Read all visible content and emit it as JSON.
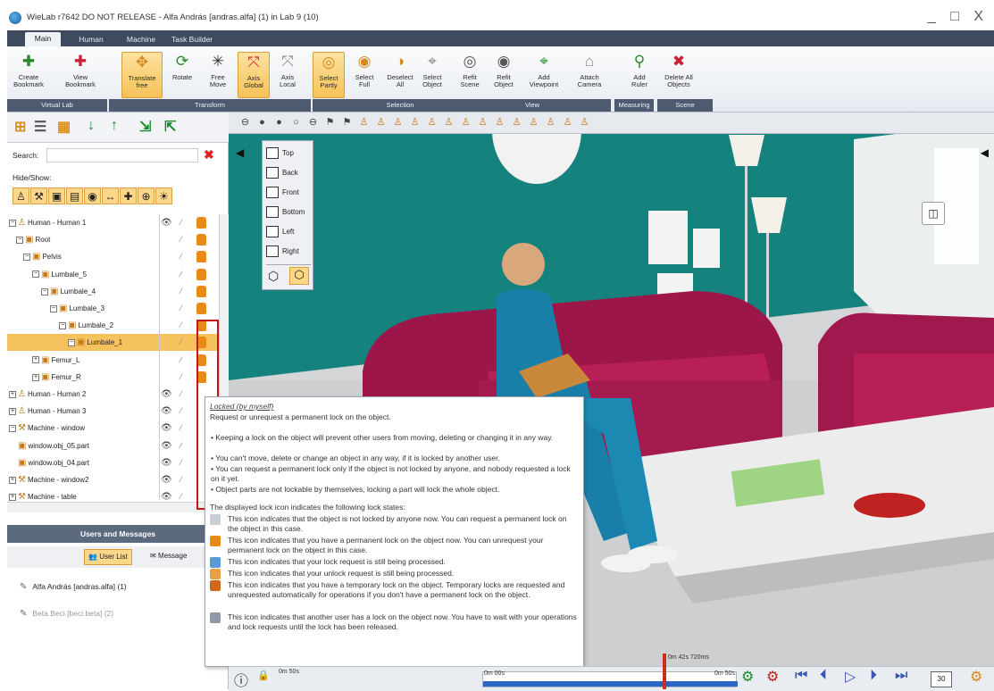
{
  "window": {
    "title": "WieLab r7642 DO NOT RELEASE - Alfa András [andras.alfa] (1) in Lab 9 (10)",
    "controls": "_ □ X"
  },
  "tabs": [
    "Main",
    "Human",
    "Machine",
    "Task Builder"
  ],
  "ribbon": {
    "buttons": [
      {
        "label": "Create\nBookmark",
        "icon": "create-bookmark-icon"
      },
      {
        "label": "View\nBookmark",
        "icon": "view-bookmark-icon"
      },
      {
        "label": "Translate\nfree",
        "icon": "translate-icon"
      },
      {
        "label": "Rotate",
        "icon": "rotate-icon"
      },
      {
        "label": "Free\nMove",
        "icon": "free-move-icon"
      },
      {
        "label": "Axis\nGlobal",
        "icon": "axis-global-icon"
      },
      {
        "label": "Axis\nLocal",
        "icon": "axis-local-icon"
      },
      {
        "label": "Select\nPartly",
        "icon": "select-partly-icon"
      },
      {
        "label": "Select\nFull",
        "icon": "select-full-icon"
      },
      {
        "label": "Deselect\nAll",
        "icon": "deselect-all-icon"
      },
      {
        "label": "Select\nObject",
        "icon": "select-object-icon"
      },
      {
        "label": "Refit\nScene",
        "icon": "refit-scene-icon"
      },
      {
        "label": "Refit\nObject",
        "icon": "refit-object-icon"
      },
      {
        "label": "Add\nViewpoint",
        "icon": "add-viewpoint-icon"
      },
      {
        "label": "Attach\nCamera",
        "icon": "attach-camera-icon"
      },
      {
        "label": "Add\nRuler",
        "icon": "add-ruler-icon"
      },
      {
        "label": "Delete All\nObjects",
        "icon": "delete-all-icon"
      }
    ],
    "groups": [
      "Virtual Lab",
      "Transform",
      "Selection",
      "View",
      "Measuring",
      "Scene"
    ]
  },
  "left_panel": {
    "search_label": "Search:",
    "search_value": "",
    "hide_show_label": "Hide/Show:",
    "tree": [
      "Human - Human 1",
      "Root",
      "Pelvis",
      "Lumbale_5",
      "Lumbale_4",
      "Lumbale_3",
      "Lumbale_2",
      "Lumbale_1",
      "Femur_L",
      "Femur_R",
      "Human - Human 2",
      "Human - Human 3",
      "Machine - window",
      "window.obj_05.part",
      "window.obj_04.part",
      "Machine - window2",
      "Machine - table"
    ],
    "selected": "Lumbale_1"
  },
  "users": {
    "header": "Users and Messages",
    "user_list_label": "User List",
    "messages_label": "Message",
    "entries": [
      "Alfa András [andras.alfa] (1)",
      "Beta Beci [beci.beta] (2)"
    ]
  },
  "view_menu": [
    "Top",
    "Back",
    "Front",
    "Bottom",
    "Left",
    "Right"
  ],
  "tooltip": {
    "title": "Locked (by myself)",
    "subtitle": "Request or unrequest a permanent lock on the object.",
    "bullets": [
      "Keeping a lock on the object will prevent other users from moving, deleting or changing it in any way.",
      "You can't move, delete or change an object in any way, if it is locked by another user.",
      "You can request a permanent lock only if the object is not locked by anyone, and nobody requested a lock on it yet.",
      "Object parts are not lockable by themselves, locking a part will lock the whole object."
    ],
    "states_intro": "The displayed lock icon indicates the following lock states:",
    "states": [
      {
        "text": "This icon indicates that the object is not locked by anyone now. You can request a permanent lock on the object in this case.",
        "color": "#c9ced6"
      },
      {
        "text": "This icon indicates that you have a permanent lock on the object now. You can unrequest your permanent lock on the object in this case.",
        "color": "#e88a14"
      },
      {
        "text": "This icon indicates that your lock request is still being processed.",
        "color": "#5a9ad8"
      },
      {
        "text": "This icon indicates that your unlock request is still being processed.",
        "color": "#e8a040"
      },
      {
        "text": "This icon indicates that you have a temporary lock on the object. Temporary locks are requested and unrequested automatically for operations if you don't have a permanent lock on the object.",
        "color": "#d06a1a"
      },
      {
        "text": "This icon indicates that another user has a lock on the object now. You have to wait with your operations and lock requests until the lock has been released.",
        "color": "#8e9aa8"
      }
    ]
  },
  "timeline": {
    "start": "0m 50s",
    "cursor": "0m 00s",
    "current": "0m 42s 720ms",
    "end": "0m 50s",
    "speed": "30"
  }
}
